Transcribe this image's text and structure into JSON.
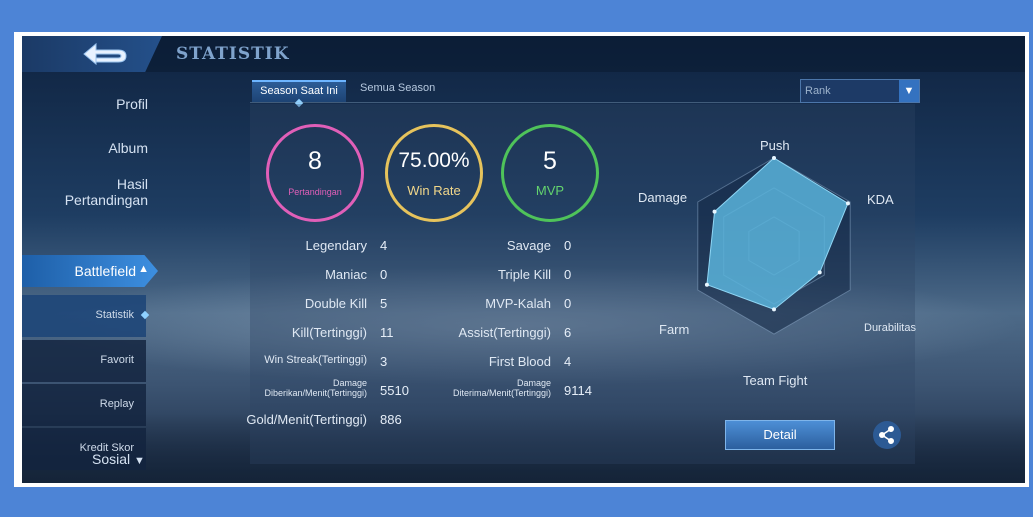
{
  "header": {
    "title": "STATISTIK",
    "back_icon": "back-arrow-icon"
  },
  "sidebar": {
    "items": [
      {
        "label": "Profil"
      },
      {
        "label": "Album"
      },
      {
        "label": "Hasil\nPertandingan"
      },
      {
        "label": "Battlefield"
      }
    ],
    "subitems": [
      {
        "label": "Statistik"
      },
      {
        "label": "Favorit"
      },
      {
        "label": "Replay"
      },
      {
        "label": "Kredit Skor"
      }
    ],
    "sosial": "Sosial"
  },
  "tabs": [
    {
      "label": "Season Saat Ini"
    },
    {
      "label": "Semua Season"
    }
  ],
  "filter": {
    "selected": "Rank"
  },
  "summary": {
    "matches": {
      "value": "8",
      "label": "Pertandingan",
      "color": "#e05fb8"
    },
    "winrate": {
      "value": "75.00%",
      "label": "Win Rate",
      "color": "#e6c35c"
    },
    "mvp": {
      "value": "5",
      "label": "MVP",
      "color": "#4fc35a"
    }
  },
  "stats_left": [
    {
      "label": "Legendary",
      "value": "4"
    },
    {
      "label": "Maniac",
      "value": "0"
    },
    {
      "label": "Double Kill",
      "value": "5"
    },
    {
      "label": "Kill(Tertinggi)",
      "value": "11"
    },
    {
      "label": "Win Streak(Tertinggi)",
      "value": "3"
    },
    {
      "label": "Damage Diberikan/Menit(Tertinggi)",
      "value": "5510"
    },
    {
      "label": "Gold/Menit(Tertinggi)",
      "value": "886"
    }
  ],
  "stats_right": [
    {
      "label": "Savage",
      "value": "0"
    },
    {
      "label": "Triple Kill",
      "value": "0"
    },
    {
      "label": "MVP-Kalah",
      "value": "0"
    },
    {
      "label": "Assist(Tertinggi)",
      "value": "6"
    },
    {
      "label": "First Blood",
      "value": "4"
    },
    {
      "label": "Damage Diterima/Menit(Tertinggi)",
      "value": "9114"
    }
  ],
  "radar": {
    "axes": [
      "Push",
      "KDA",
      "Durabilitas",
      "Team Fight",
      "Farm",
      "Damage"
    ],
    "levels": [
      1.0,
      0.97,
      0.6,
      0.72,
      0.88,
      0.78
    ],
    "fill": "#5ab4dc"
  },
  "buttons": {
    "detail": "Detail",
    "share_icon": "share-icon"
  }
}
